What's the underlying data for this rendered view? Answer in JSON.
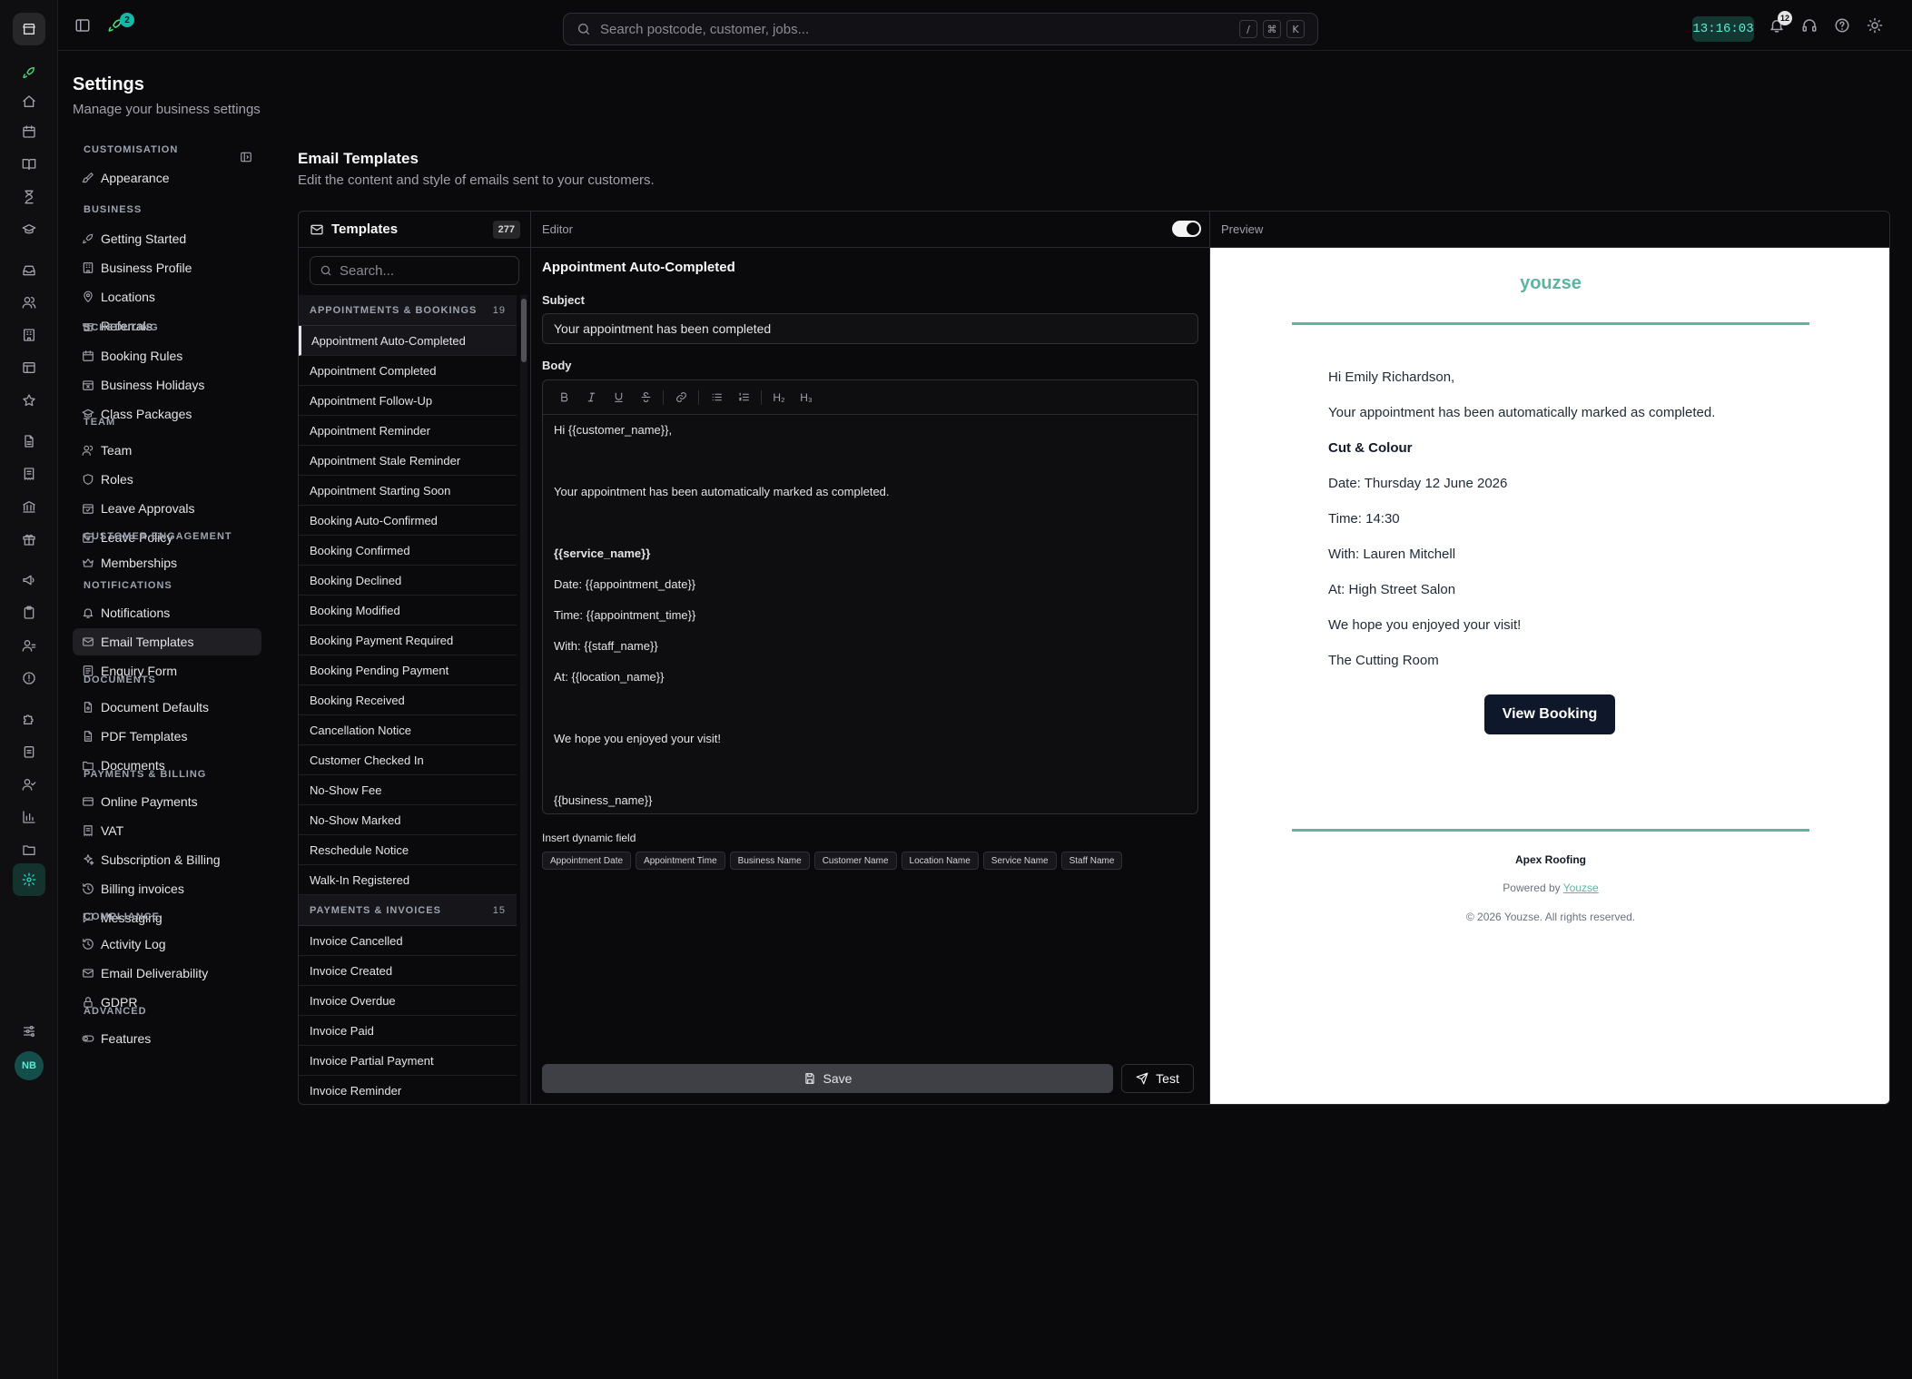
{
  "topbar": {
    "notif_badge_launch": "2",
    "search_placeholder": "Search postcode, customer, jobs...",
    "shortcut_keys": [
      "/",
      "⌘",
      "K"
    ],
    "clock": "13:16:03",
    "notif_count": "12"
  },
  "page": {
    "title": "Settings",
    "subtitle": "Manage your business settings"
  },
  "nav": {
    "sections": [
      {
        "title": "CUSTOMISATION",
        "items": [
          {
            "label": "Appearance",
            "icon": "brush-icon"
          }
        ]
      },
      {
        "title": "BUSINESS",
        "items": [
          {
            "label": "Getting Started",
            "icon": "rocket-icon"
          },
          {
            "label": "Business Profile",
            "icon": "building-icon"
          },
          {
            "label": "Locations",
            "icon": "pin-icon"
          },
          {
            "label": "Referrals",
            "icon": "gift-icon"
          }
        ]
      },
      {
        "title": "SCHEDULING",
        "items": [
          {
            "label": "Booking Rules",
            "icon": "calendar-icon"
          },
          {
            "label": "Business Holidays",
            "icon": "calendar-x-icon"
          },
          {
            "label": "Class Packages",
            "icon": "graduation-cap-icon"
          }
        ]
      },
      {
        "title": "TEAM",
        "items": [
          {
            "label": "Team",
            "icon": "users-icon"
          },
          {
            "label": "Roles",
            "icon": "shield-icon"
          },
          {
            "label": "Leave Approvals",
            "icon": "calendar-check-icon"
          },
          {
            "label": "Leave Policy",
            "icon": "calendar-cog-icon"
          }
        ]
      },
      {
        "title": "CUSTOMER ENGAGEMENT",
        "items": [
          {
            "label": "Memberships",
            "icon": "crown-icon"
          }
        ]
      },
      {
        "title": "NOTIFICATIONS",
        "items": [
          {
            "label": "Notifications",
            "icon": "bell-icon"
          },
          {
            "label": "Email Templates",
            "icon": "mail-icon"
          },
          {
            "label": "Enquiry Form",
            "icon": "form-icon"
          }
        ]
      },
      {
        "title": "DOCUMENTS",
        "items": [
          {
            "label": "Document Defaults",
            "icon": "file-cog-icon"
          },
          {
            "label": "PDF Templates",
            "icon": "file-icon"
          },
          {
            "label": "Documents",
            "icon": "folder-icon"
          }
        ]
      },
      {
        "title": "PAYMENTS & BILLING",
        "items": [
          {
            "label": "Online Payments",
            "icon": "credit-card-icon"
          },
          {
            "label": "VAT",
            "icon": "receipt-icon"
          },
          {
            "label": "Subscription & Billing",
            "icon": "sparkles-icon"
          },
          {
            "label": "Billing invoices",
            "icon": "history-icon"
          },
          {
            "label": "Messaging",
            "icon": "message-icon"
          }
        ]
      },
      {
        "title": "COMPLIANCE",
        "items": [
          {
            "label": "Activity Log",
            "icon": "history-icon"
          },
          {
            "label": "Email Deliverability",
            "icon": "mail-check-icon"
          },
          {
            "label": "GDPR",
            "icon": "lock-icon"
          }
        ]
      },
      {
        "title": "ADVANCED",
        "items": [
          {
            "label": "Features",
            "icon": "toggle-icon"
          }
        ]
      }
    ]
  },
  "content": {
    "title": "Email Templates",
    "subtitle": "Edit the content and style of emails sent to your customers."
  },
  "templates": {
    "header": "Templates",
    "count": "277",
    "search_placeholder": "Search...",
    "groups": [
      {
        "name": "APPOINTMENTS & BOOKINGS",
        "count": "19",
        "items": [
          "Appointment Auto-Completed",
          "Appointment Completed",
          "Appointment Follow-Up",
          "Appointment Reminder",
          "Appointment Stale Reminder",
          "Appointment Starting Soon",
          "Booking Auto-Confirmed",
          "Booking Confirmed",
          "Booking Declined",
          "Booking Modified",
          "Booking Payment Required",
          "Booking Pending Payment",
          "Booking Received",
          "Cancellation Notice",
          "Customer Checked In",
          "No-Show Fee",
          "No-Show Marked",
          "Reschedule Notice",
          "Walk-In Registered"
        ]
      },
      {
        "name": "PAYMENTS & INVOICES",
        "count": "15",
        "items": [
          "Invoice Cancelled",
          "Invoice Created",
          "Invoice Overdue",
          "Invoice Paid",
          "Invoice Partial Payment",
          "Invoice Reminder"
        ]
      }
    ],
    "selected": "Appointment Auto-Completed"
  },
  "editor": {
    "header": "Editor",
    "template_name": "Appointment Auto-Completed",
    "subject_label": "Subject",
    "subject_value": "Your appointment has been completed",
    "body_label": "Body",
    "toolbar": [
      "B",
      "I",
      "U",
      "S",
      "link",
      "bullet-list",
      "ordered-list",
      "H₂",
      "H₃"
    ],
    "body_lines": [
      "Hi {{customer_name}},",
      "",
      "Your appointment has been automatically marked as completed.",
      "",
      "{{service_name}}",
      "Date: {{appointment_date}}",
      "Time: {{appointment_time}}",
      "With: {{staff_name}}",
      "At: {{location_name}}",
      "",
      "We hope you enjoyed your visit!",
      "",
      "{{business_name}}"
    ],
    "dynamic_title": "Insert dynamic field",
    "dynamic_fields": [
      "Appointment Date",
      "Appointment Time",
      "Business Name",
      "Customer Name",
      "Location Name",
      "Service Name",
      "Staff Name"
    ],
    "save_label": "Save",
    "test_label": "Test"
  },
  "preview": {
    "header": "Preview",
    "brand": "youzse",
    "lines": [
      {
        "text": "Hi Emily Richardson,",
        "bold": false
      },
      {
        "text": "Your appointment has been automatically marked as completed.",
        "bold": false
      },
      {
        "text": "Cut & Colour",
        "bold": true
      },
      {
        "text": "Date: Thursday 12 June 2026",
        "bold": false
      },
      {
        "text": "Time: 14:30",
        "bold": false
      },
      {
        "text": "With: Lauren Mitchell",
        "bold": false
      },
      {
        "text": "At: High Street Salon",
        "bold": false
      },
      {
        "text": "We hope you enjoyed your visit!",
        "bold": false
      },
      {
        "text": "The Cutting Room",
        "bold": false
      }
    ],
    "button": "View Booking",
    "footer_business": "Apex Roofing",
    "powered_by": "Powered by",
    "powered_link": "Youzse",
    "copyright": "© 2026 Youzse. All rights reserved."
  },
  "user": {
    "initials": "NB"
  },
  "colors": {
    "accent": "#2dd4bf",
    "brand_green": "#5fb3a1",
    "button_navy": "#0f172a"
  }
}
